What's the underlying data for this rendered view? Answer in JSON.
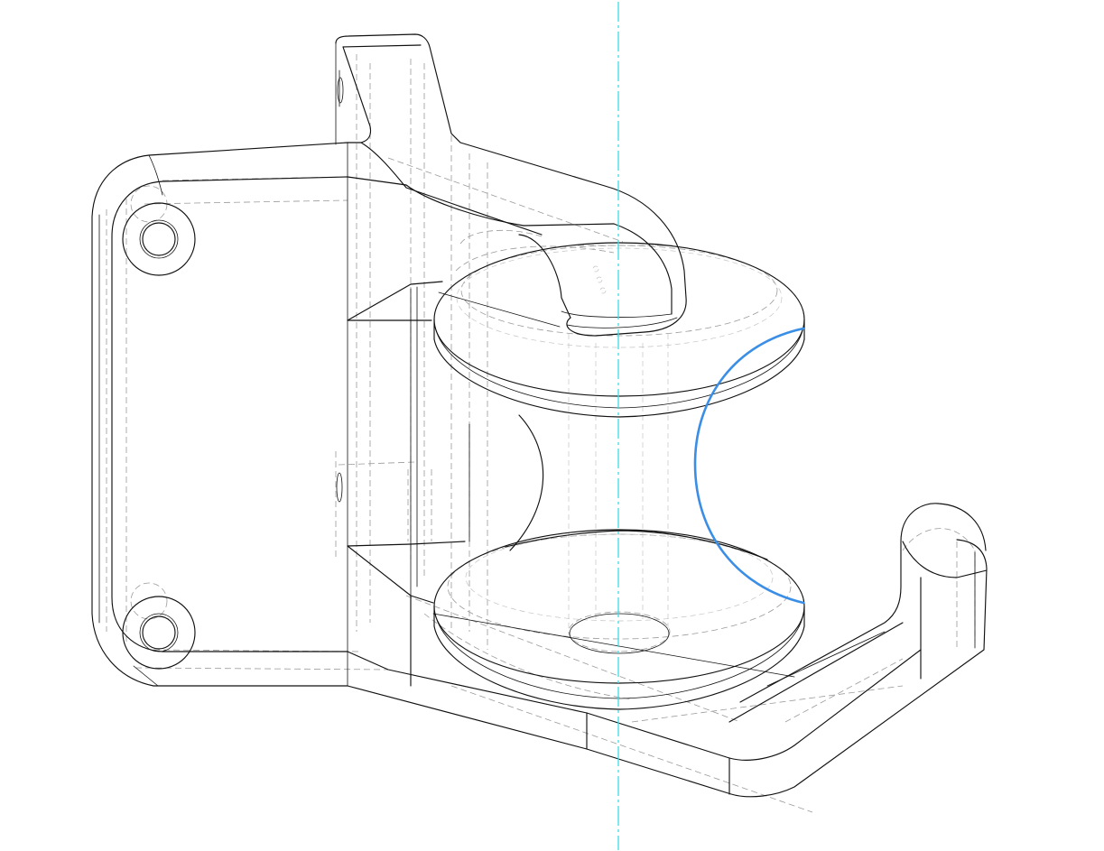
{
  "viewport": {
    "name": "isometric-hidden-line-view",
    "background": "#ffffff"
  },
  "part": {
    "name": "spool-guide-bracket",
    "edge_color": "#111111",
    "hidden_edge_color": "#9a9a9a"
  },
  "axis": {
    "name": "rotation-axis-centerline",
    "color": "#3ddbe6"
  },
  "selection": {
    "name": "selected-fillet-edge",
    "color": "#3a8ee6"
  }
}
